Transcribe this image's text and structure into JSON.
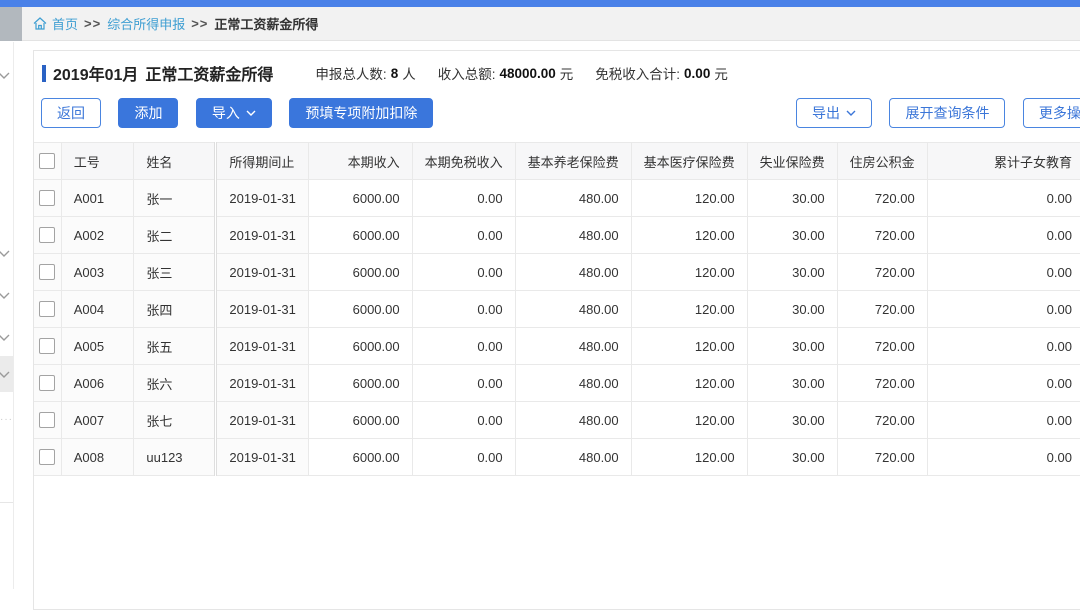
{
  "breadcrumb": {
    "home": "首页",
    "separator": ">>",
    "parent": "综合所得申报",
    "current": "正常工资薪金所得"
  },
  "header": {
    "period": "2019年01月",
    "title": "正常工资薪金所得",
    "stats": [
      {
        "label": "申报总人数:",
        "value": "8",
        "unit": "人"
      },
      {
        "label": "收入总额:",
        "value": "48000.00",
        "unit": "元"
      },
      {
        "label": "免税收入合计:",
        "value": "0.00",
        "unit": "元"
      }
    ]
  },
  "toolbar": {
    "back": "返回",
    "add": "添加",
    "import": "导入",
    "prefill": "预填专项附加扣除",
    "export": "导出",
    "expand_query": "展开查询条件",
    "more": "更多操作"
  },
  "table": {
    "columns": [
      "工号",
      "姓名",
      "所得期间止",
      "本期收入",
      "本期免税收入",
      "基本养老保险费",
      "基本医疗保险费",
      "失业保险费",
      "住房公积金",
      "累计子女教育"
    ],
    "rows": [
      [
        "A001",
        "张一",
        "2019-01-31",
        "6000.00",
        "0.00",
        "480.00",
        "120.00",
        "30.00",
        "720.00",
        "0.00"
      ],
      [
        "A002",
        "张二",
        "2019-01-31",
        "6000.00",
        "0.00",
        "480.00",
        "120.00",
        "30.00",
        "720.00",
        "0.00"
      ],
      [
        "A003",
        "张三",
        "2019-01-31",
        "6000.00",
        "0.00",
        "480.00",
        "120.00",
        "30.00",
        "720.00",
        "0.00"
      ],
      [
        "A004",
        "张四",
        "2019-01-31",
        "6000.00",
        "0.00",
        "480.00",
        "120.00",
        "30.00",
        "720.00",
        "0.00"
      ],
      [
        "A005",
        "张五",
        "2019-01-31",
        "6000.00",
        "0.00",
        "480.00",
        "120.00",
        "30.00",
        "720.00",
        "0.00"
      ],
      [
        "A006",
        "张六",
        "2019-01-31",
        "6000.00",
        "0.00",
        "480.00",
        "120.00",
        "30.00",
        "720.00",
        "0.00"
      ],
      [
        "A007",
        "张七",
        "2019-01-31",
        "6000.00",
        "0.00",
        "480.00",
        "120.00",
        "30.00",
        "720.00",
        "0.00"
      ],
      [
        "A008",
        "uu123",
        "2019-01-31",
        "6000.00",
        "0.00",
        "480.00",
        "120.00",
        "30.00",
        "720.00",
        "0.00"
      ]
    ]
  },
  "colors": {
    "accent_blue": "#3a76dc",
    "top_strip_blue": "#4a81e8",
    "link_teal": "#3e9ed2",
    "title_bar_blue": "#2a62c4"
  }
}
